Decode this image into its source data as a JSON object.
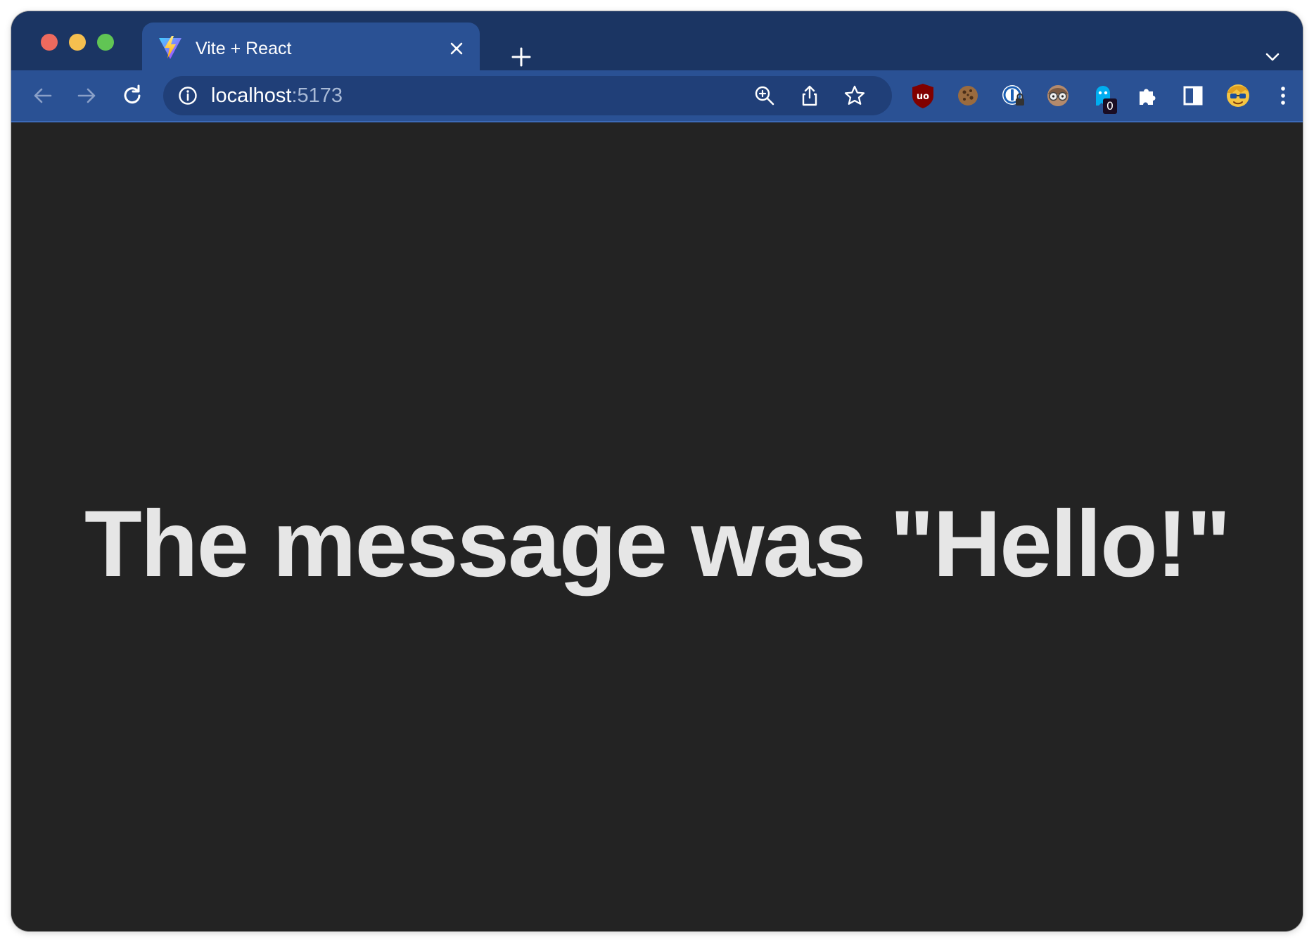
{
  "browser": {
    "tab": {
      "title": "Vite + React",
      "favicon": "vite-logo-icon"
    },
    "address": {
      "host": "localhost",
      "port": ":5173"
    },
    "extensions": [
      {
        "name": "ublock-origin-icon"
      },
      {
        "name": "cookie-icon"
      },
      {
        "name": "onepassword-icon"
      },
      {
        "name": "glasses-face-icon"
      },
      {
        "name": "ghostery-icon",
        "badge": "0"
      },
      {
        "name": "puzzle-extensions-icon"
      },
      {
        "name": "side-panel-icon"
      },
      {
        "name": "profile-avatar-icon"
      }
    ],
    "colors": {
      "tabstrip": "#1b3563",
      "active_tab": "#2a5194",
      "page_background": "#232323",
      "text": "#e6e6e6"
    }
  },
  "page": {
    "message": "The message was \"Hello!\""
  }
}
